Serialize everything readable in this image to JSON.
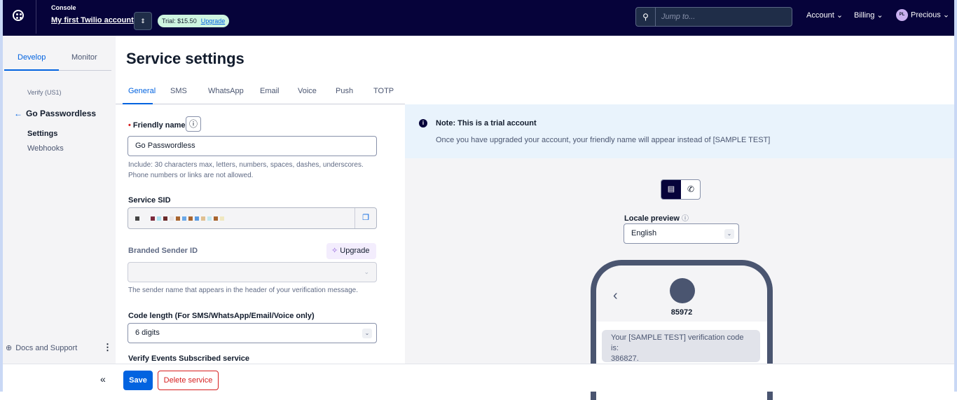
{
  "topbar": {
    "console_label": "Console",
    "account_name": "My first Twilio account",
    "trial_label": "Trial: $15.50",
    "upgrade_link": "Upgrade",
    "search_placeholder": "Jump to...",
    "account_menu": "Account",
    "billing_menu": "Billing",
    "user_initials": "PL",
    "user_name": "Precious"
  },
  "sidebar": {
    "tabs": [
      {
        "label": "Develop",
        "active": true
      },
      {
        "label": "Monitor",
        "active": false
      }
    ],
    "section": "Verify (US1)",
    "service_name": "Go Passwordless",
    "items": [
      {
        "label": "Settings",
        "active": true
      },
      {
        "label": "Webhooks",
        "active": false
      }
    ],
    "docs_support": "Docs and Support"
  },
  "page": {
    "title": "Service settings",
    "tabs": [
      "General",
      "SMS",
      "WhatsApp",
      "Email",
      "Voice",
      "Push",
      "TOTP"
    ],
    "active_tab": "General"
  },
  "form": {
    "friendly_name": {
      "label": "Friendly name",
      "value": "Go Passwordless",
      "help1": "Include: 30 characters max, letters, numbers, spaces, dashes, underscores.",
      "help2": "Phone numbers or links are not allowed."
    },
    "service_sid": {
      "label": "Service SID"
    },
    "branded_sender": {
      "label": "Branded Sender ID",
      "upgrade": "Upgrade",
      "help": "The sender name that appears in the header of your verification message."
    },
    "code_length": {
      "label": "Code length (For SMS/WhatsApp/Email/Voice only)",
      "value": "6 digits"
    },
    "events": {
      "label": "Verify Events Subscribed service"
    }
  },
  "preview": {
    "note_title": "Note: This is a trial account",
    "note_text": "Once you have upgraded your account, your friendly name will appear instead of [SAMPLE TEST]",
    "locale_label": "Locale preview",
    "locale_value": "English",
    "sender": "85972",
    "message_line1": "Your [SAMPLE TEST] verification code is:",
    "message_line2": "386827."
  },
  "footer": {
    "save": "Save",
    "delete": "Delete service"
  },
  "colors": {
    "topbar": "#06033a",
    "accent": "#0263e0",
    "danger": "#d61f1f"
  }
}
